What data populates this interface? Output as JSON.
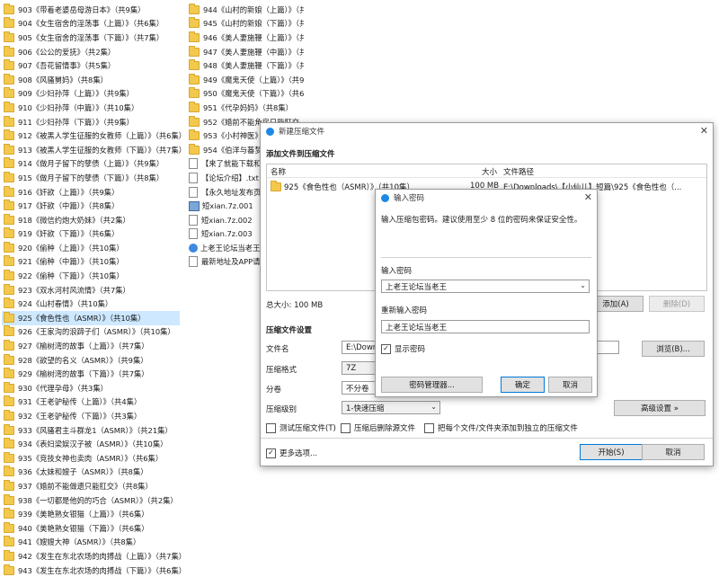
{
  "explorer": {
    "col1": [
      "903《带着老婆岳母游日本》（共9集）",
      "904《女生宿舍的淫荡事（上篇）》（共6集）",
      "905《女生宿舍的淫荡事（下篇）》（共7集）",
      "906《公公的爱抚》（共2集）",
      "907《吾花留情事》（共5集）",
      "908《风骚舅妈》（共8集）",
      "909《少妇孙萍（上篇）》（共9集）",
      "910《少妇孙萍（中篇）》（共10集）",
      "911《少妇孙萍（下篇）》（共9集）",
      "912《被黑人学生征服的女教师（上篇）》（共6集）",
      "913《被黑人学生征服的女教师（下篇）》（共7集）",
      "914《做月子留下的孽债（上篇）》（共9集）",
      "915《做月子留下的孽债（下篇）》（共8集）",
      "916《奸欲（上篇）》（共9集）",
      "917《奸欲（中篇）》（共8集）",
      "918《微信约炮大奶妹》（共2集）",
      "919《奸欲（下篇）》（共6集）",
      "920《偷种（上篇）》（共10集）",
      "921《偷种（中篇）》（共10集）",
      "922《偷种（下篇）》（共10集）",
      "923《双水河村风流情》（共7集）",
      "924《山村春情》（共10集）",
      "925《食色性也（ASMR）》（共10集）",
      "926《王家沟的浪蹄子们（ASMR）》（共10集）",
      "927《榆树湾的故事（上篇）》（共7集）",
      "928《欲望的名义（ASMR）》（共9集）",
      "929《榆树湾的故事（下篇）》（共7集）",
      "930《代理孕母》（共3集）",
      "931《王老驴秘传（上篇）》（共4集）",
      "932《王老驴秘传（下篇）》（共3集）",
      "933《风骚君主斗群龙1（ASMR）》（共21集）",
      "934《表妇梁娱汉子被（ASMR）》（共10集）",
      "935《竞技女神也卖肉（ASMR）》（共6集）",
      "936《太妹和嫂子（ASMR）》（共8集）",
      "937《婚前不能做遗只能肛交》（共8集）",
      "938《一切都是他妈的巧合（ASMR）》（共2集）",
      "939《美艳熟女银猫（上篇）》（共6集）",
      "940《美艳熟女银猫（下篇）》（共6集）",
      "941《嫂嫂大神（ASMR）》（共8集）",
      "942《发生在东北农场的肉搏战（上篇）》（共7集）",
      "943《发生在东北农场的肉搏战（下篇）》（共6集）"
    ],
    "selected_index": 22,
    "col2_folders": [
      "944《山村的新娘（上篇）》（共7集）",
      "945《山村的新娘（下篇）》（共6集）",
      "946《美人妻施鞭（上篇）》（共4集）",
      "947《美人妻施鞭（中篇）》（共9集）",
      "948《美人妻施鞭（下篇）》（共8集）",
      "949《魔鬼天使（上篇）》（共9集）",
      "950《魔鬼天使（下篇）》（共6集）",
      "951《代孕妈妈》（共8集）",
      "952《婚前不能角房只能肛交（续）》（共9集）",
      "953《小村神医》（共8集）",
      "954《伯洋与蕃梦之"
    ],
    "col2_files": [
      {
        "name": "【来了就能下载和观",
        "icon": "file-icon"
      },
      {
        "name": "【论坛介绍】.txt",
        "icon": "file-icon"
      },
      {
        "name": "【永久地址发布页】",
        "icon": "file-icon"
      },
      {
        "name": "短xian.7z.001",
        "icon": "archive-icon"
      },
      {
        "name": "短xian.7z.002",
        "icon": "file-icon"
      },
      {
        "name": "短xian.7z.003",
        "icon": "file-icon"
      },
      {
        "name": "上老王论坛当老王.c",
        "icon": "web-icon"
      },
      {
        "name": "最新地址及APP请发",
        "icon": "file-icon"
      }
    ]
  },
  "compress_dialog": {
    "title": "新建压缩文件",
    "add_section": "添加文件到压缩文件",
    "col_name": "名称",
    "col_size": "大小",
    "col_path": "文件路径",
    "file_name": "925《食色性也（ASMR）》（共10集）",
    "file_size": "100 MB",
    "file_path": "E:\\Downloads\\【小仙儿】短篇\\925《食色性也（...",
    "total_size": "总大小: 100 MB",
    "add_button": "添加(A)",
    "delete_button": "删除(D)",
    "settings_section": "压缩文件设置",
    "filename_label": "文件名",
    "filename_value": "E:\\Downlo",
    "browse_button": "浏览(B)...",
    "format_label": "压缩格式",
    "format_value": "7Z",
    "split_label": "分卷",
    "split_value": "不分卷",
    "level_label": "压缩级别",
    "level_value": "1-快速压缩",
    "advanced_button": "高级设置 »",
    "test_label": "测试压缩文件(T)",
    "delete_after_label": "压缩后删除源文件",
    "each_separate_label": "把每个文件/文件夹添加到独立的压缩文件",
    "more_options_label": "更多选项...",
    "start_button": "开始(S)",
    "cancel_button": "取消"
  },
  "password_dialog": {
    "title": "输入密码",
    "hint": "输入压缩包密码。建议使用至少 8 位的密码来保证安全性。",
    "pwd_label": "输入密码",
    "pwd_value": "上老王论坛当老王",
    "repeat_label": "重新输入密码",
    "repeat_value": "上老王论坛当老王",
    "show_pwd_label": "显示密码",
    "manager_button": "密码管理器...",
    "ok_button": "确定",
    "cancel_button": "取消"
  }
}
